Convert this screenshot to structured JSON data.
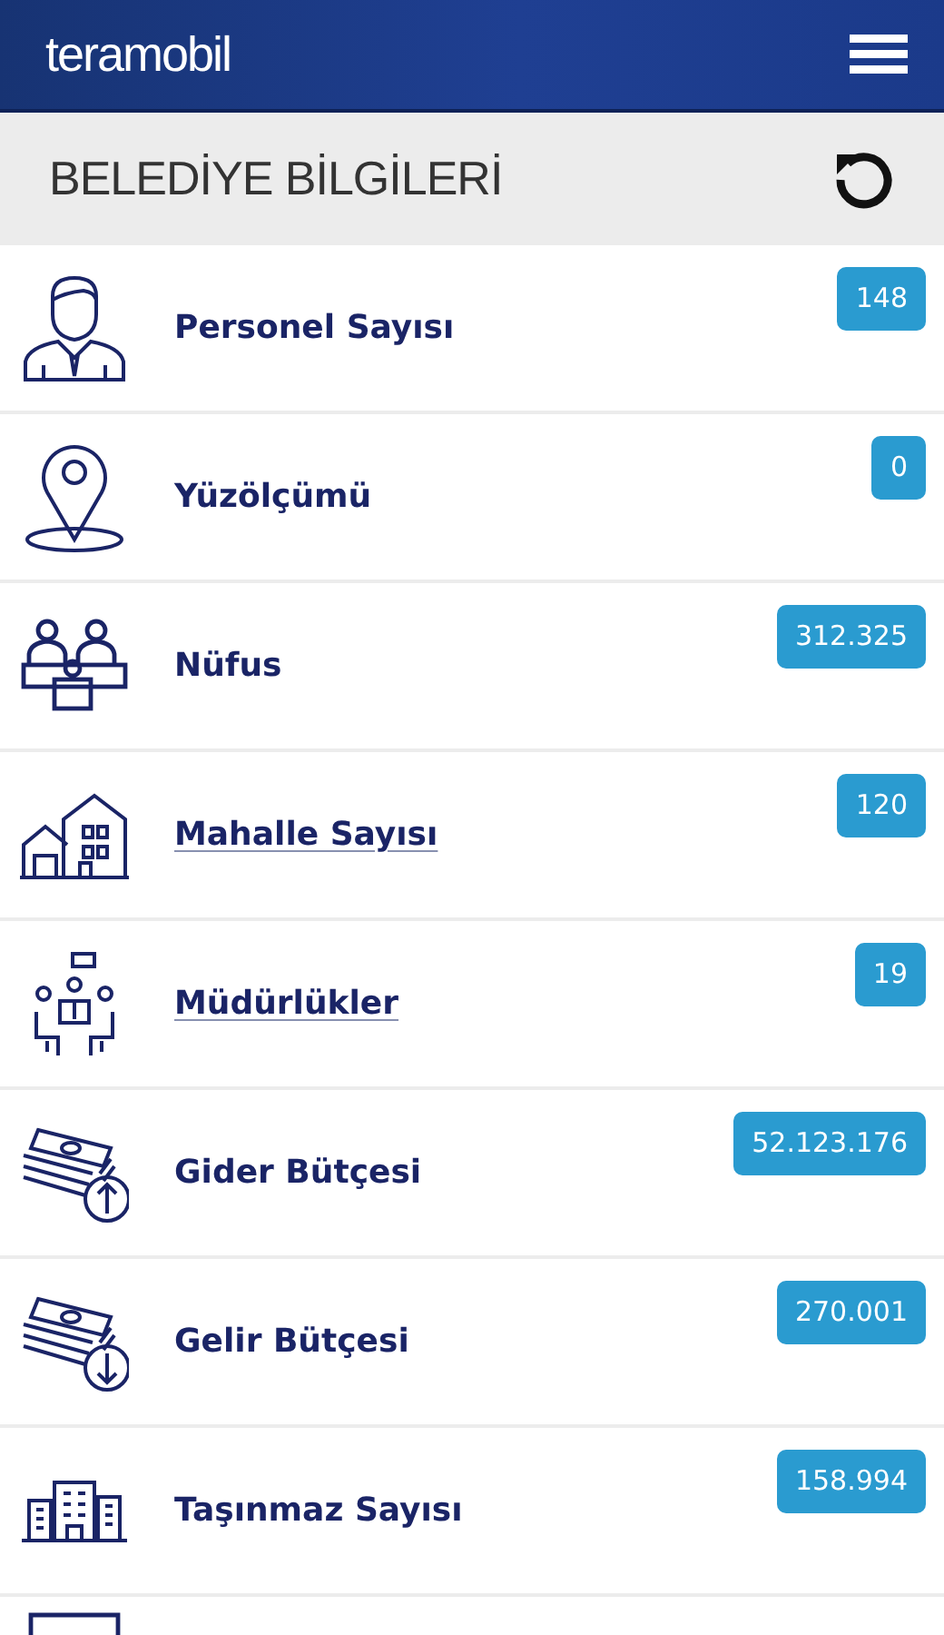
{
  "header": {
    "logo": "teramobil"
  },
  "section": {
    "title": "BELEDİYE BİLGİLERİ"
  },
  "items": [
    {
      "kind": "person",
      "label": "Personel Sayısı",
      "value": "148",
      "link": false
    },
    {
      "kind": "pin",
      "label": "Yüzölçümü",
      "value": "0",
      "link": false
    },
    {
      "kind": "people",
      "label": "Nüfus",
      "value": "312.325",
      "link": false
    },
    {
      "kind": "houses",
      "label": "Mahalle Sayısı",
      "value": "120",
      "link": true
    },
    {
      "kind": "meeting",
      "label": "Müdürlükler",
      "value": "19",
      "link": true
    },
    {
      "kind": "moneyup",
      "label": "Gider Bütçesi",
      "value": "52.123.176",
      "link": false
    },
    {
      "kind": "moneydown",
      "label": "Gelir Bütçesi",
      "value": "270.001",
      "link": false
    },
    {
      "kind": "buildings",
      "label": "Taşınmaz Sayısı",
      "value": "158.994",
      "link": false
    },
    {
      "kind": "monitor"
    }
  ]
}
